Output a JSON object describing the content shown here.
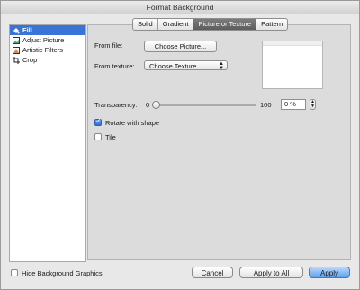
{
  "window": {
    "title": "Format Background"
  },
  "sidebar": {
    "items": [
      {
        "label": "Fill",
        "icon": "fill-bucket-icon",
        "selected": true
      },
      {
        "label": "Adjust Picture",
        "icon": "adjust-picture-icon",
        "selected": false
      },
      {
        "label": "Artistic Filters",
        "icon": "artistic-filters-icon",
        "selected": false
      },
      {
        "label": "Crop",
        "icon": "crop-icon",
        "selected": false
      }
    ]
  },
  "tabs": [
    {
      "label": "Solid",
      "active": false
    },
    {
      "label": "Gradient",
      "active": false
    },
    {
      "label": "Picture or Texture",
      "active": true
    },
    {
      "label": "Pattern",
      "active": false
    }
  ],
  "fill": {
    "from_file_label": "From file:",
    "choose_picture_label": "Choose Picture...",
    "from_texture_label": "From texture:",
    "texture_select_value": "Choose Texture",
    "transparency_label": "Transparency:",
    "slider_min": "0",
    "slider_max": "100",
    "transparency_value": "0 %",
    "transparency_fraction": 0,
    "rotate_label": "Rotate with shape",
    "rotate_checked": true,
    "tile_label": "Tile",
    "tile_checked": false
  },
  "footer": {
    "hide_bg_label": "Hide Background Graphics",
    "hide_bg_checked": false,
    "cancel_label": "Cancel",
    "apply_all_label": "Apply to All",
    "apply_label": "Apply"
  },
  "colors": {
    "selection": "#3875d7",
    "default_button": "#5ea1ee"
  }
}
